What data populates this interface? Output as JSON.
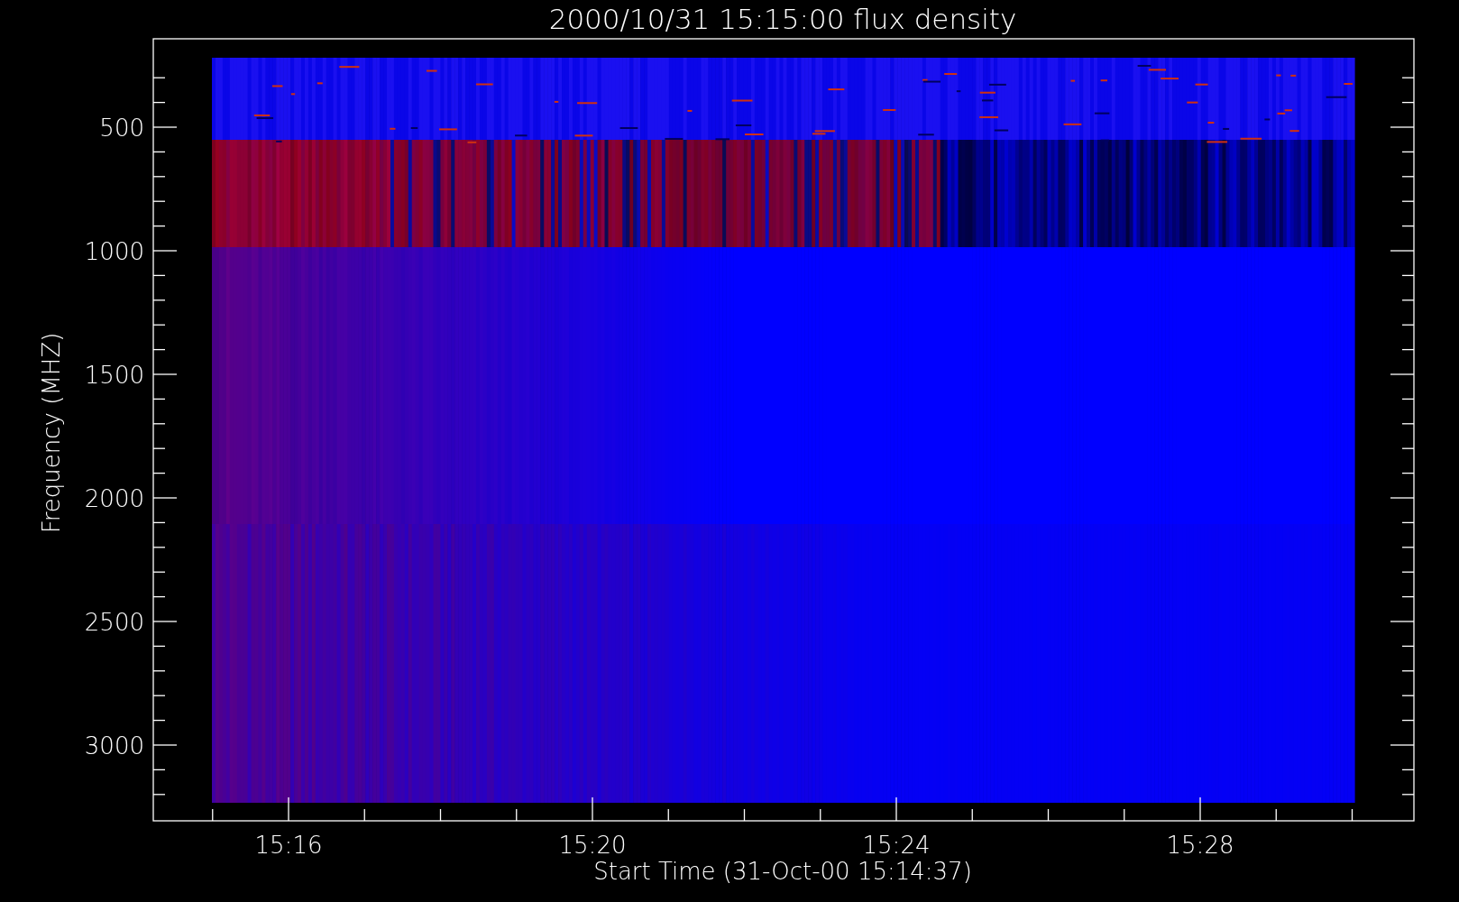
{
  "title": "2000/10/31 15:15:00 flux density",
  "y_axis": {
    "title": "Frequency (MHZ)",
    "tick_labels": [
      "500",
      "1000",
      "1500",
      "2000",
      "2500",
      "3000"
    ]
  },
  "x_axis": {
    "title": "Start Time (31-Oct-00 15:14:37)",
    "tick_labels": [
      "15:16",
      "15:20",
      "15:24",
      "15:28"
    ]
  }
}
